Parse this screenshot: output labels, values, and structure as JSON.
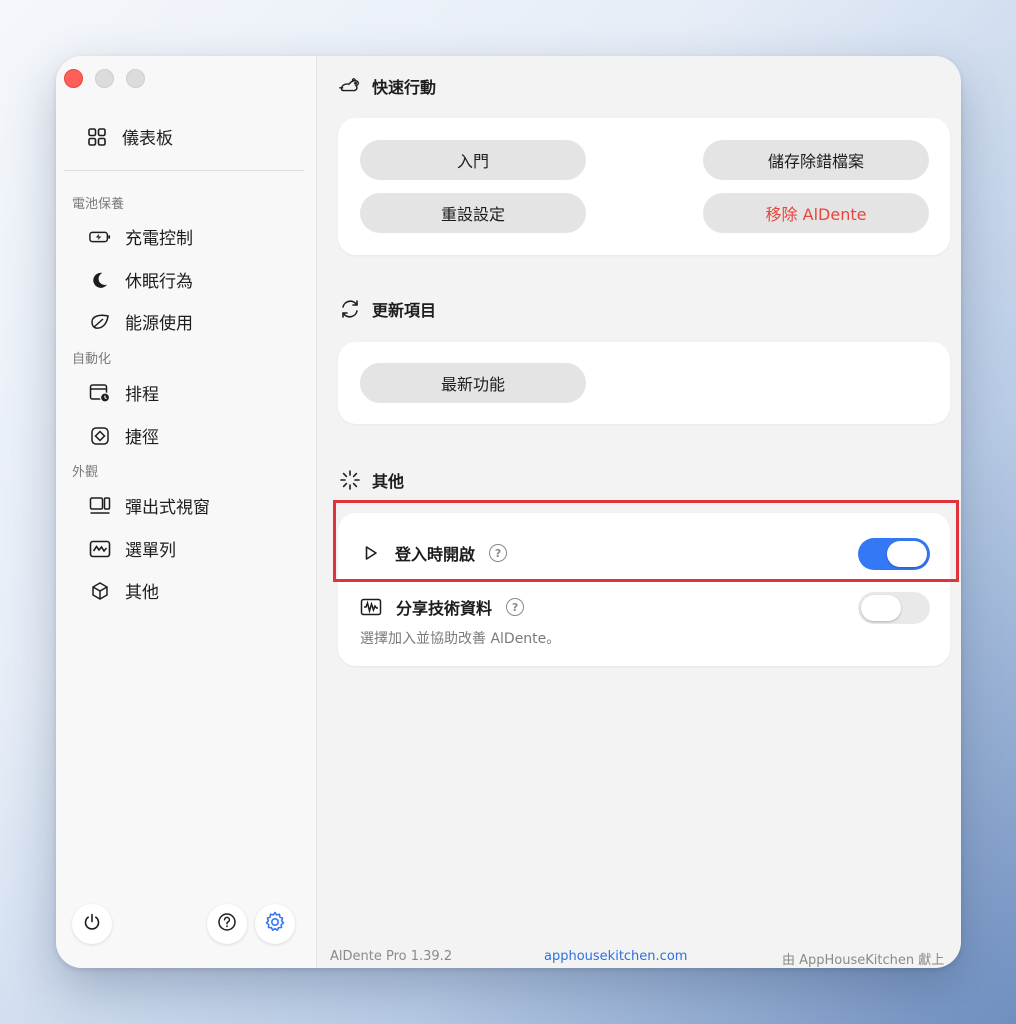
{
  "sidebar": {
    "dashboard": "儀表板",
    "sections": {
      "battery": "電池保養",
      "automation": "自動化",
      "appearance": "外觀"
    },
    "items": {
      "charge_control": "充電控制",
      "sleep_behavior": "休眠行為",
      "energy_use": "能源使用",
      "schedule": "排程",
      "shortcuts": "捷徑",
      "popup_window": "彈出式視窗",
      "menu_bar": "選單列",
      "other": "其他"
    }
  },
  "main": {
    "quick_actions": {
      "title": "快速行動",
      "buttons": {
        "getting_started": "入門",
        "save_debug": "儲存除錯檔案",
        "reset_settings": "重設設定",
        "remove_app": "移除 AlDente"
      }
    },
    "updates": {
      "title": "更新項目",
      "whats_new": "最新功能"
    },
    "other": {
      "title": "其他",
      "launch_at_login": {
        "label": "登入時開啟",
        "enabled": true
      },
      "share_technical_data": {
        "label": "分享技術資料",
        "enabled": false,
        "description": "選擇加入並協助改善 AlDente。"
      }
    }
  },
  "footer": {
    "version": "AlDente Pro 1.39.2",
    "website": "apphousekitchen.com",
    "credit": "由 AppHouseKitchen 獻上"
  },
  "colors": {
    "accent": "#3478f6",
    "danger": "#e8453c",
    "highlight": "#e0333a",
    "close": "#ff5f57"
  },
  "help_glyph": "?"
}
